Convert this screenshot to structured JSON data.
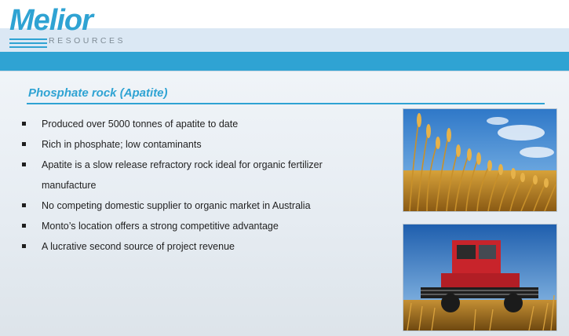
{
  "brand": {
    "logo_word": "Melior",
    "logo_subtitle": "RESOURCES",
    "accent_color": "#2fa3d3"
  },
  "slide": {
    "title": "Phosphate rock (Apatite)",
    "bullets": [
      "Produced over 5000 tonnes of apatite to date",
      "Rich in phosphate; low contaminants",
      "Apatite is a slow release refractory rock ideal for organic fertilizer manufacture",
      "No competing domestic supplier to organic market in Australia",
      "Monto’s location offers a strong competitive advantage",
      "A lucrative second source of project revenue"
    ]
  },
  "images": {
    "top": "wheat-field-photo",
    "bottom": "combine-harvester-photo"
  }
}
